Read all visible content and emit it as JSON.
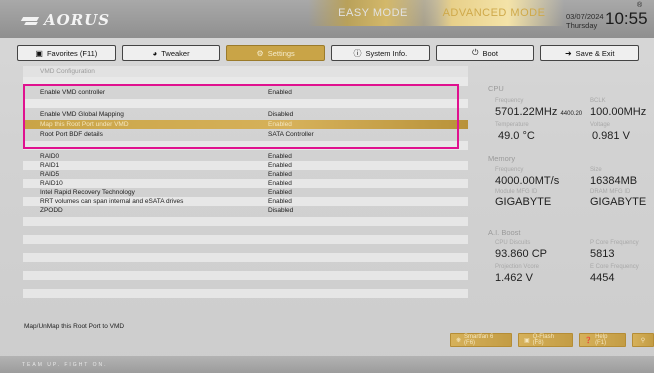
{
  "brand": {
    "logo": "AORUS"
  },
  "modes": {
    "easy": "EASY MODE",
    "advanced": "ADVANCED MODE"
  },
  "datetime": {
    "date": "03/07/2024",
    "day": "Thursday",
    "time": "10:55",
    "reg": "®"
  },
  "tabs": [
    {
      "label": "Favorites (F11)",
      "icon": "favorites-icon",
      "active": false
    },
    {
      "label": "Tweaker",
      "icon": "tweaker-icon",
      "active": false
    },
    {
      "label": "Settings",
      "icon": "settings-icon",
      "active": true
    },
    {
      "label": "System Info.",
      "icon": "info-icon",
      "active": false
    },
    {
      "label": "Boot",
      "icon": "power-icon",
      "active": false
    },
    {
      "label": "Save & Exit",
      "icon": "exit-icon",
      "active": false
    }
  ],
  "settings": {
    "section_title": "VMD Configuration",
    "rows": [
      {
        "label": "Enable VMD controller",
        "value": "Enabled"
      },
      {
        "label": "Enable VMD Global Mapping",
        "value": "Disabled"
      },
      {
        "label": "Map this Root Port under VMD",
        "value": "Enabled"
      },
      {
        "label": "Root Port BDF details",
        "value": "SATA Controller"
      },
      {
        "label": "RAID0",
        "value": "Enabled"
      },
      {
        "label": "RAID1",
        "value": "Enabled"
      },
      {
        "label": "RAID5",
        "value": "Enabled"
      },
      {
        "label": "RAID10",
        "value": "Enabled"
      },
      {
        "label": "Intel Rapid Recovery Technology",
        "value": "Enabled"
      },
      {
        "label": "RRT volumes can span internal and eSATA drives",
        "value": "Enabled"
      },
      {
        "label": "ZPODD",
        "value": "Disabled"
      }
    ],
    "help": "Map/UnMap this Root Port to VMD"
  },
  "cpu": {
    "title": "CPU",
    "freq_label": "Frequency",
    "freq": "5701.22MHz",
    "freq_sub": "4400.20",
    "bclk_label": "BCLK",
    "bclk": "100.00MHz",
    "temp_label": "Temperature",
    "temp": "49.0 °C",
    "volt_label": "Voltage",
    "volt": "0.981 V"
  },
  "memory": {
    "title": "Memory",
    "freq_label": "Frequency",
    "freq": "4000.00MT/s",
    "size_label": "Size",
    "size": "16384MB",
    "mfg_label": "Module MFG ID",
    "mfg": "GIGABYTE",
    "dram_label": "DRAM MFG ID",
    "dram": "GIGABYTE"
  },
  "aiboost": {
    "title": "A.I. Boost",
    "cp_label": "CPU Discuits",
    "cp": "93.860 CP",
    "pfreq_label": "P Core Frequency",
    "pfreq": "5813",
    "vcore_label": "Projection Vcore",
    "vcore": "1.462 V",
    "efreq_label": "E Core Frequency",
    "efreq": "4454"
  },
  "footer": {
    "btn1": "Smartfan 6 (F6)",
    "btn2": "Q-Flash (F8)",
    "btn3": "Help (F1)",
    "bottom_text": "TEAM UP. FIGHT ON."
  },
  "colors": {
    "accent": "#c9a447",
    "highlight_box": "#e0118f"
  }
}
